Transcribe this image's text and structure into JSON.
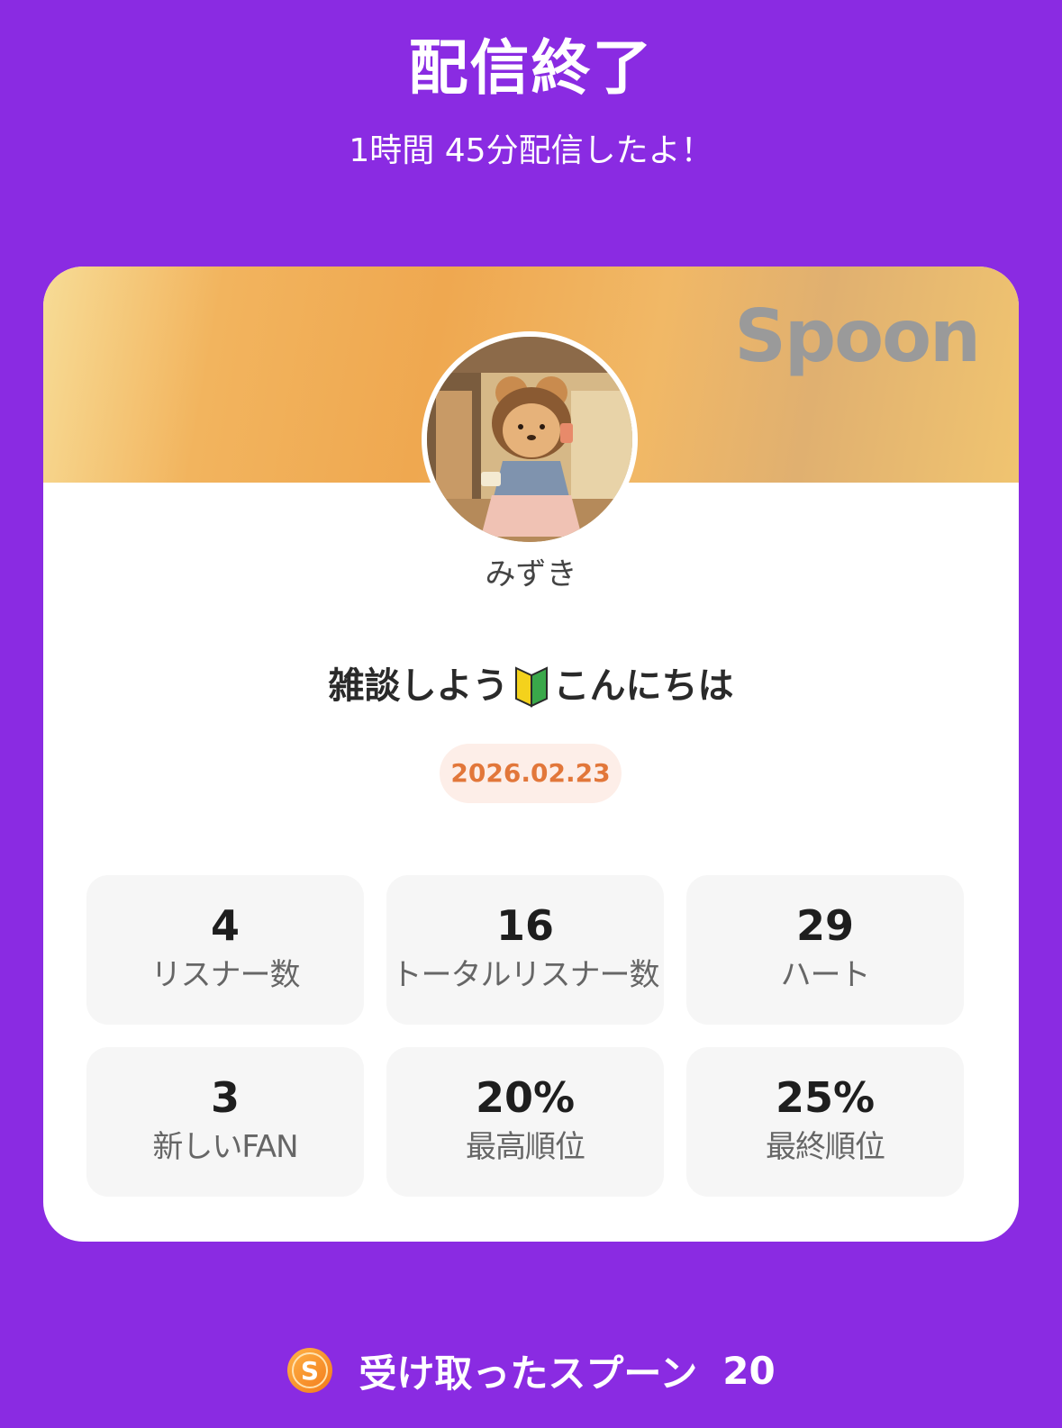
{
  "header": {
    "title": "配信終了",
    "subtitle": "1時間 45分配信したよ！"
  },
  "card": {
    "brand": "Spoon",
    "username": "みずき",
    "live_title_before": "雑談しよう",
    "live_title_icon": "beginner-mark-icon",
    "live_title_after": "こんにちは",
    "date": "2026.02.23",
    "stats": [
      {
        "value": "4",
        "label": "リスナー数"
      },
      {
        "value": "16",
        "label": "トータルリスナー数"
      },
      {
        "value": "29",
        "label": "ハート"
      },
      {
        "value": "3",
        "label": "新しいFAN"
      },
      {
        "value": "20%",
        "label": "最高順位"
      },
      {
        "value": "25%",
        "label": "最終順位"
      }
    ]
  },
  "footer": {
    "coin_icon": "spoon-coin-icon",
    "coin_letter": "S",
    "label": "受け取ったスプーン",
    "count": "20"
  },
  "colors": {
    "background": "#8a2be2",
    "date_text": "#e2773a",
    "date_bg": "#fdeee8"
  }
}
